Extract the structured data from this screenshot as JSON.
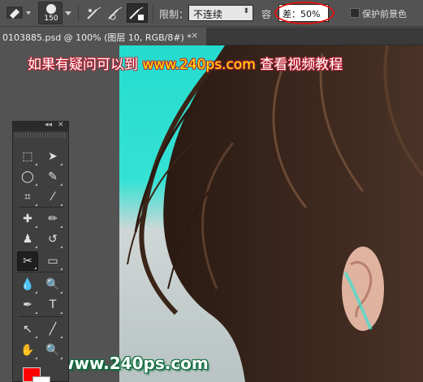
{
  "options_bar": {
    "brush_size": "150",
    "limit_label": "限制：",
    "limit_value": "不连续",
    "tolerance_label": "容",
    "tolerance_value": "差：50%",
    "checkbox_label": "保护前景色",
    "tool_icons": [
      "sampling-icon",
      "brush-preset-icon",
      "sampling-continuous-icon",
      "sampling-once-icon",
      "sampling-background-icon"
    ]
  },
  "document_tab": {
    "title": "0103885.psd @ 100% (图层 10, RGB/8#) *",
    "close_glyph": "×"
  },
  "banner": {
    "prefix": "如果有疑问可以到",
    "url": "www.240ps.com",
    "suffix": "查看视频教程"
  },
  "watermark": "www.240ps.com",
  "tools_panel": {
    "collapse_glyph": "◂◂",
    "close_glyph": "✕",
    "tools": [
      {
        "name": "marquee-tool-icon",
        "glyph": "⬚"
      },
      {
        "name": "move-tool-icon",
        "glyph": "➤"
      },
      {
        "name": "lasso-tool-icon",
        "glyph": "◯"
      },
      {
        "name": "quick-selection-tool-icon",
        "glyph": "✎"
      },
      {
        "name": "crop-tool-icon",
        "glyph": "⌗"
      },
      {
        "name": "eyedropper-tool-icon",
        "glyph": "⁄"
      },
      {
        "name": "healing-brush-tool-icon",
        "glyph": "✚"
      },
      {
        "name": "brush-tool-icon",
        "glyph": "✏"
      },
      {
        "name": "clone-stamp-tool-icon",
        "glyph": "♟"
      },
      {
        "name": "history-brush-tool-icon",
        "glyph": "↺"
      },
      {
        "name": "background-eraser-tool-icon",
        "glyph": "✂"
      },
      {
        "name": "gradient-tool-icon",
        "glyph": "▭"
      },
      {
        "name": "blur-tool-icon",
        "glyph": "💧"
      },
      {
        "name": "dodge-tool-icon",
        "glyph": "🔍"
      },
      {
        "name": "pen-tool-icon",
        "glyph": "✒"
      },
      {
        "name": "type-tool-icon",
        "glyph": "T"
      },
      {
        "name": "path-selection-tool-icon",
        "glyph": "↖"
      },
      {
        "name": "line-tool-icon",
        "glyph": "╱"
      },
      {
        "name": "hand-tool-icon",
        "glyph": "✋"
      },
      {
        "name": "zoom-tool-icon",
        "glyph": "🔍"
      }
    ],
    "active_tool": "background-eraser-tool-icon",
    "foreground_color": "#ff0000",
    "background_color": "#ffffff"
  }
}
